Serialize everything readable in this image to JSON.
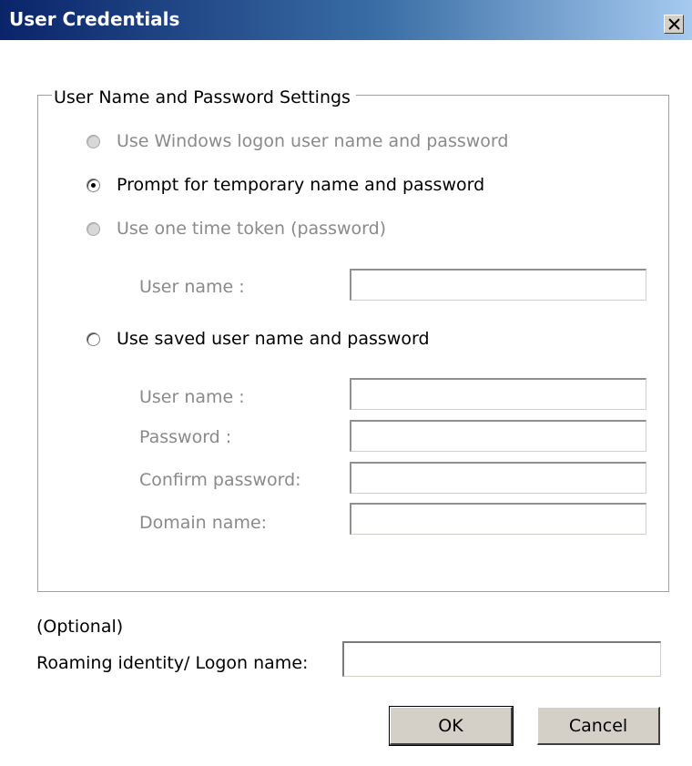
{
  "window": {
    "title": "User Credentials",
    "close_label": "×"
  },
  "group": {
    "legend": "User Name and Password Settings",
    "options": [
      {
        "label": "Use Windows logon user name and password",
        "selected": false,
        "enabled": false
      },
      {
        "label": "Prompt for temporary name and password",
        "selected": true,
        "enabled": true
      },
      {
        "label": "Use one time token (password)",
        "selected": false,
        "enabled": false
      },
      {
        "label": "Use saved user name and password",
        "selected": false,
        "enabled": true
      }
    ],
    "token_fields": {
      "username_label": "User name :",
      "username_value": ""
    },
    "saved_fields": {
      "username_label": "User name :",
      "username_value": "",
      "password_label": "Password :",
      "password_value": "",
      "confirm_label": "Confirm password:",
      "confirm_value": "",
      "domain_label": "Domain name:",
      "domain_value": ""
    }
  },
  "optional": {
    "label": "(Optional)",
    "roaming_label": "Roaming identity/ Logon name:",
    "roaming_value": ""
  },
  "buttons": {
    "ok": "OK",
    "cancel": "Cancel"
  }
}
